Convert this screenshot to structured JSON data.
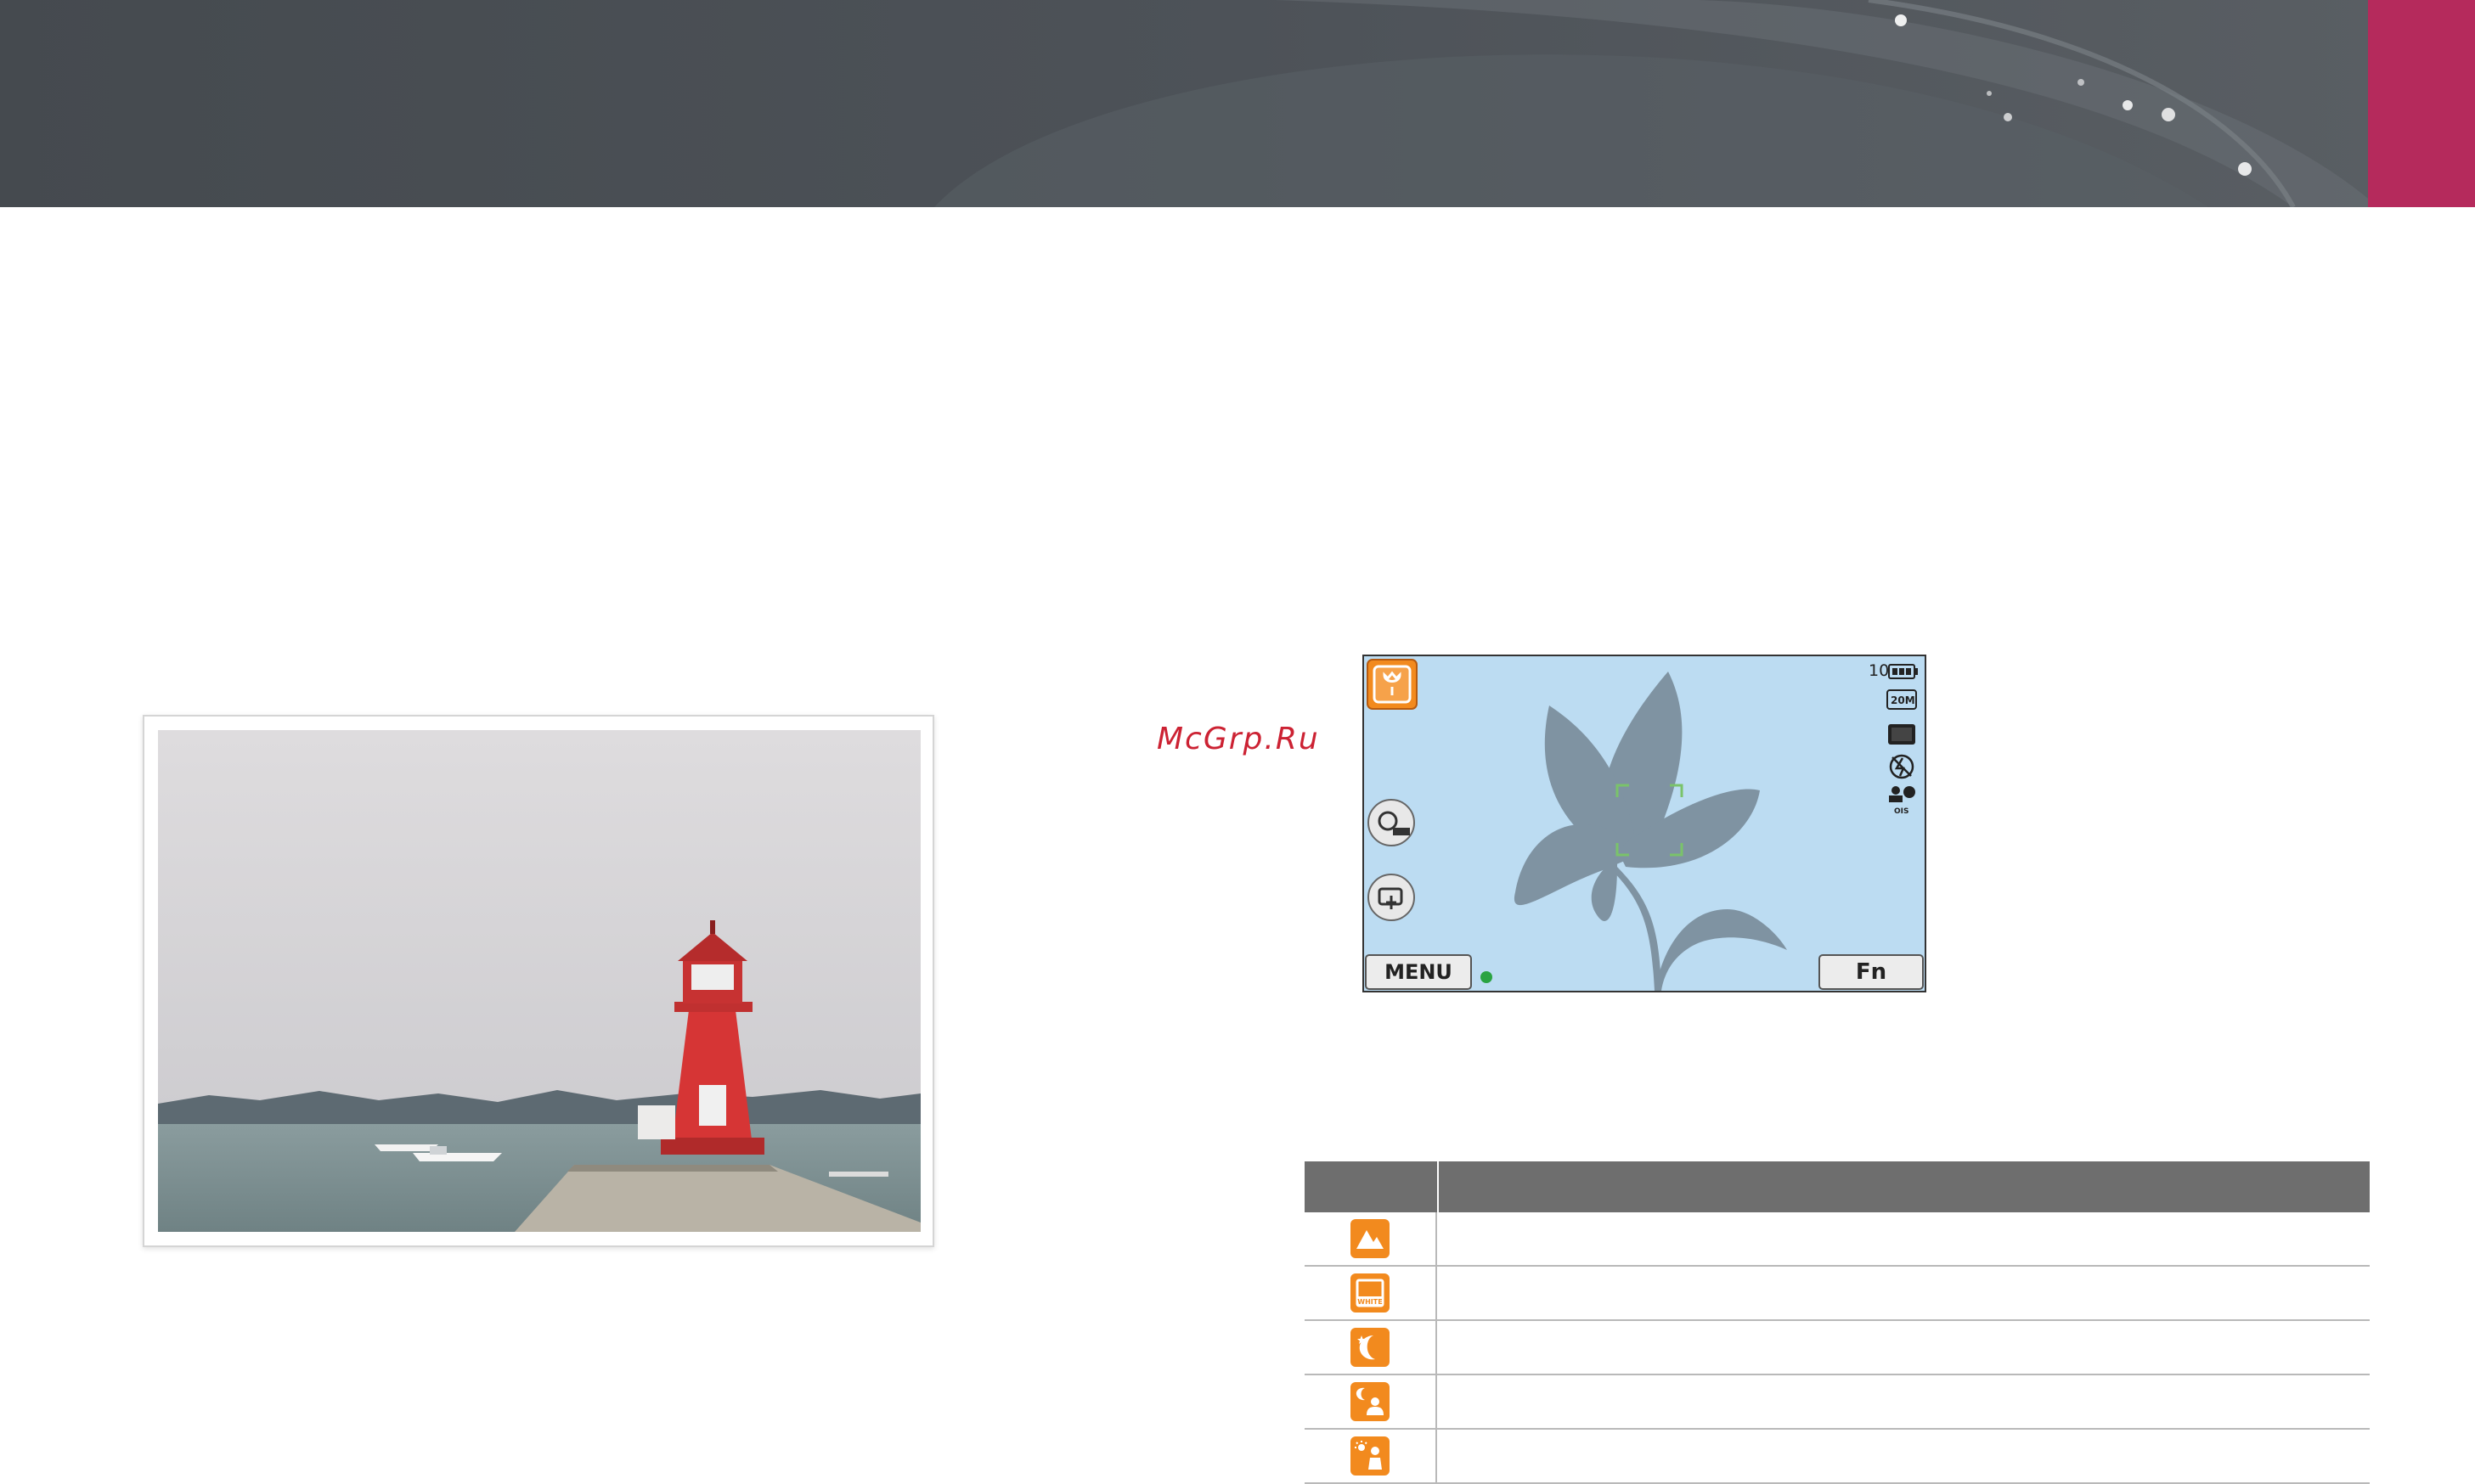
{
  "watermark": "McGrp.Ru",
  "colors": {
    "accent": "#b52a5c",
    "banner": "#4a4f54",
    "lcd": "#bcdcf2",
    "scene_icon": "#f28a1e"
  },
  "camera_screen": {
    "shots_remaining": "10",
    "resolution_icon": "20M",
    "menu_label": "MENU",
    "fn_label": "Fn",
    "icons": [
      "macro-mode-icon",
      "battery-icon",
      "resolution-icon",
      "quality-icon",
      "flash-off-icon",
      "ois-icon",
      "smart-filter-off-icon",
      "touch-shot-icon",
      "focus-frame-icon"
    ]
  },
  "scene_table": {
    "rows": [
      {
        "icon": "landscape-icon"
      },
      {
        "icon": "white-scene-icon",
        "icon_text": "WHITE"
      },
      {
        "icon": "night-icon"
      },
      {
        "icon": "night-portrait-icon"
      },
      {
        "icon": "backlit-portrait-icon"
      }
    ]
  }
}
